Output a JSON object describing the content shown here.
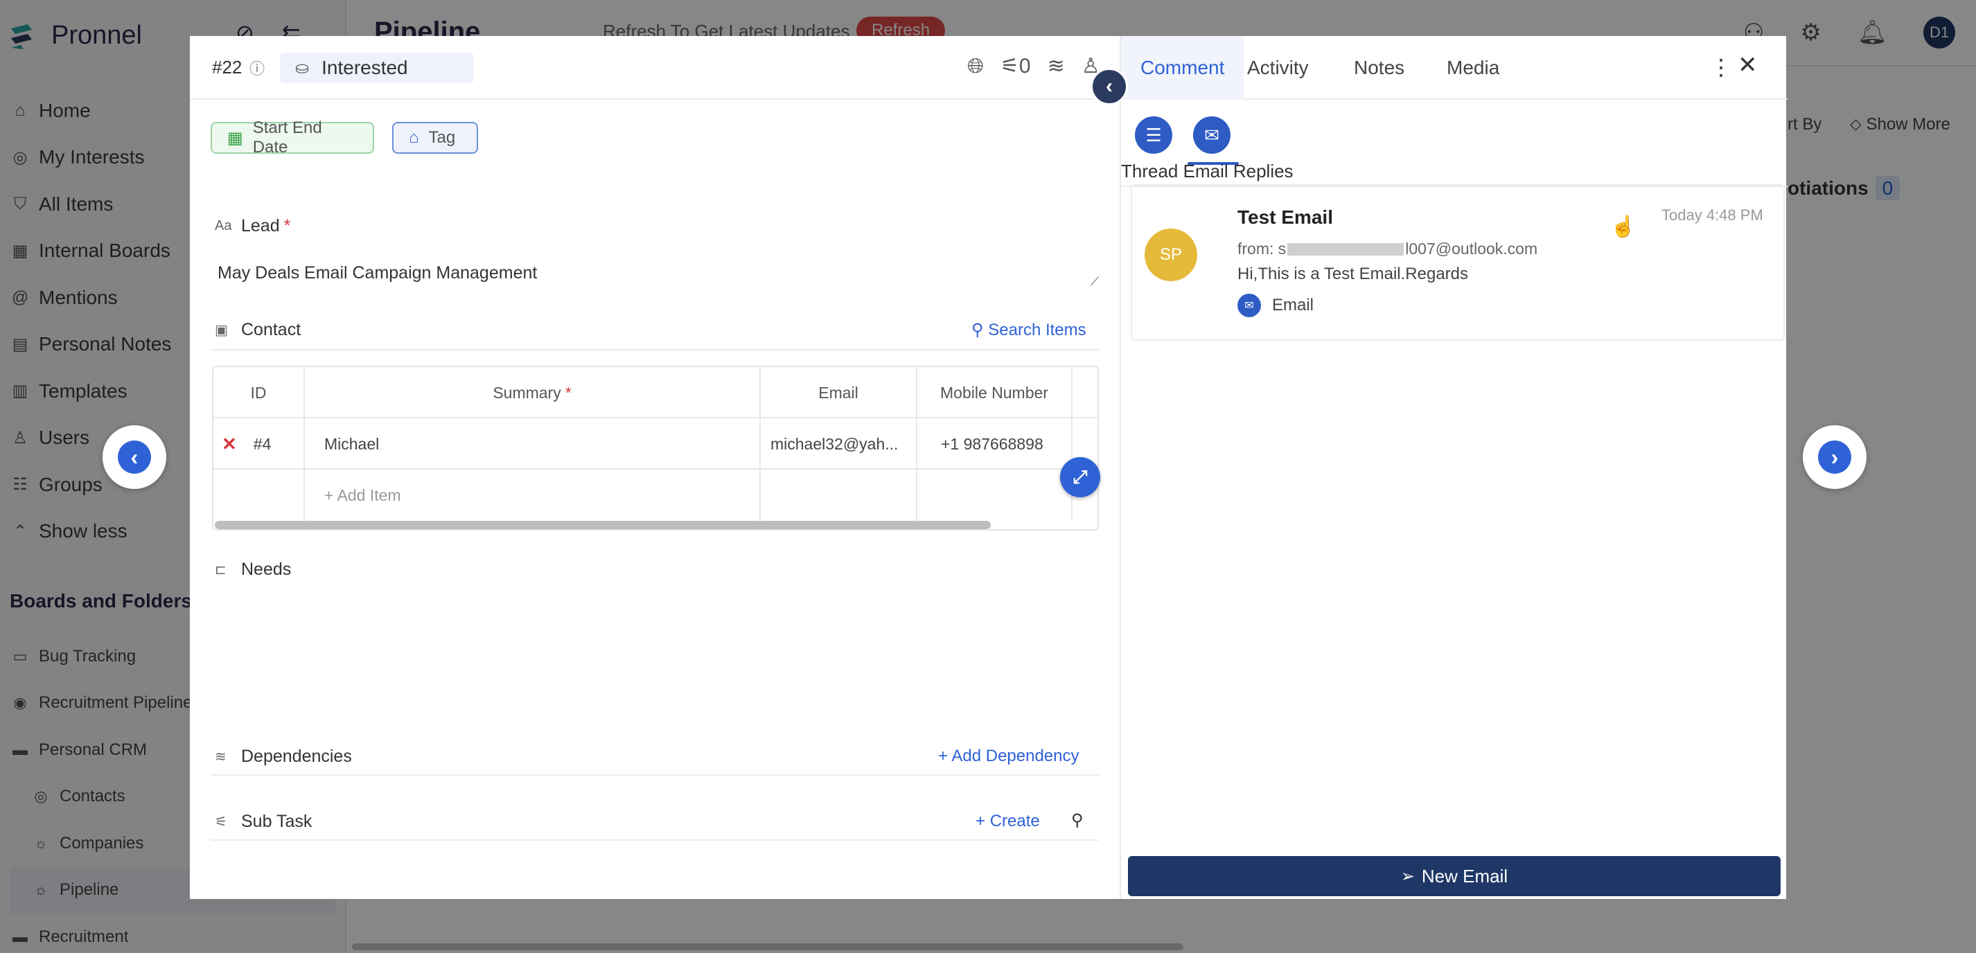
{
  "app": {
    "brand": "Pronnel",
    "page_title": "Pipeline",
    "refresh_text": "Refresh To Get Latest Updates",
    "refresh_button": "Refresh",
    "user_initials": "D1",
    "sort_by": "rt By",
    "show_more": "Show More",
    "negotiations": "otiations",
    "negotiations_count": "0"
  },
  "sidebar": {
    "items": [
      {
        "label": "Home",
        "icon": "home-icon",
        "glyph": "⌂"
      },
      {
        "label": "My Interests",
        "icon": "interests-icon",
        "glyph": "◎"
      },
      {
        "label": "All Items",
        "icon": "items-icon",
        "glyph": "⛉"
      },
      {
        "label": "Internal Boards",
        "icon": "boards-icon",
        "glyph": "▦"
      },
      {
        "label": "Mentions",
        "icon": "at-icon",
        "glyph": "@"
      },
      {
        "label": "Personal Notes",
        "icon": "notes-icon",
        "glyph": "▤"
      },
      {
        "label": "Templates",
        "icon": "templates-icon",
        "glyph": "▥"
      },
      {
        "label": "Users",
        "icon": "user-icon",
        "glyph": "♙"
      },
      {
        "label": "Groups",
        "icon": "group-icon",
        "glyph": "☷"
      },
      {
        "label": "Show less",
        "icon": "chevron-up-icon",
        "glyph": "⌃"
      }
    ],
    "section_title": "Boards and Folders",
    "folders": [
      {
        "label": "Bug Tracking",
        "icon": "board-icon",
        "glyph": "▭",
        "sub": false
      },
      {
        "label": "Recruitment Pipeline",
        "icon": "pipeline-icon",
        "glyph": "◉",
        "sub": false
      },
      {
        "label": "Personal CRM",
        "icon": "folder-icon",
        "glyph": "▬",
        "sub": false
      },
      {
        "label": "Contacts",
        "icon": "contacts-icon",
        "glyph": "◎",
        "sub": true
      },
      {
        "label": "Companies",
        "icon": "bulb-icon",
        "glyph": "☼",
        "sub": true
      },
      {
        "label": "Pipeline",
        "icon": "bulb-icon",
        "glyph": "☼",
        "sub": true
      },
      {
        "label": "Recruitment",
        "icon": "folder-icon",
        "glyph": "▬",
        "sub": false
      }
    ]
  },
  "modal": {
    "item_id": "#22",
    "status": "Interested",
    "subtask_count": "0",
    "chips": {
      "date": "Start End Date",
      "tag": "Tag"
    },
    "lead_label": "Lead",
    "lead_value": "May Deals Email Campaign Management",
    "contact_label": "Contact",
    "search_items": "Search Items",
    "table": {
      "headers": [
        "ID",
        "Summary",
        "Email",
        "Mobile Number"
      ],
      "rows": [
        {
          "id": "#4",
          "summary": "Michael",
          "email": "michael32@yah...",
          "mobile": "+1 987668898"
        }
      ],
      "add_item": "+ Add Item"
    },
    "needs_label": "Needs",
    "dependencies_label": "Dependencies",
    "add_dependency": "Add Dependency",
    "subtask_label": "Sub Task",
    "create": "Create"
  },
  "comments": {
    "tabs": [
      "Comment",
      "Activity",
      "Notes",
      "Media"
    ],
    "active_tab": "Comment",
    "thread_title": "Thread Email Replies",
    "email": {
      "avatar": "SP",
      "subject": "Test Email",
      "from_prefix": "from: s",
      "from_suffix": "l007@outlook.com",
      "body": "Hi,This is a Test Email.Regards",
      "type": "Email",
      "time": "Today 4:48 PM"
    },
    "new_email": "New Email"
  },
  "colors": {
    "accent": "#2f62d6",
    "navy": "#1f3766",
    "avatar_yellow": "#e5b93a",
    "danger": "#d9363e"
  }
}
